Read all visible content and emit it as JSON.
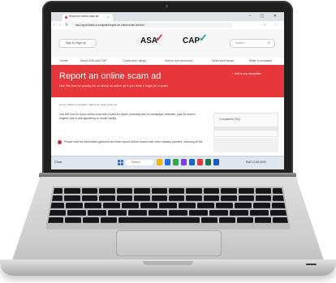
{
  "browser": {
    "tab_title": "Report an online scam ad",
    "url": "asa.org.uk/make-a-complaint/report-an-online-scam-ad.html",
    "window_controls": "– ▢ ✕",
    "nav_glyphs": "‹ › ↻",
    "addr_icons": "☆ ⋮"
  },
  "site": {
    "signin_label": "Sign in | Sign up",
    "logo_asa": "ASA",
    "logo_cap": "CAP",
    "search_placeholder": "Search...",
    "nav": [
      "Home",
      "About ASA and CAP",
      "Codes and rulings",
      "Advice and resources",
      "News and Issues",
      "Make a complaint"
    ],
    "hero_title": "Report an online scam ad",
    "hero_subtitle": "Use this form to quickly tell us about an online ad if you think it might be a scam",
    "favourites_label": "Add to my favourites",
    "breadcrumb": "Home  ›  Make a complaint  ›  Report an online scam ad",
    "body_text": "Use this form to report online scam ads in paid-for space (including ads on newspaper websites, paid-for search engines ads or ads appearing on social media).",
    "side_box_title": "Complaints FAQ",
    "notice_text": "Please read the information gathered via these reports will be shared with other industry partners, including all the"
  },
  "taskbar": {
    "weather": "Clear",
    "search_label": "Search",
    "tray_text": "ENG  12:55  24/05"
  },
  "colors": {
    "hero": "#e8373a",
    "asa_tick": "#d12a2a",
    "cap_tick": "#1aa4a4",
    "laptop_lid": "#1f1f21",
    "laptop_deck": "#d4d4d4"
  }
}
